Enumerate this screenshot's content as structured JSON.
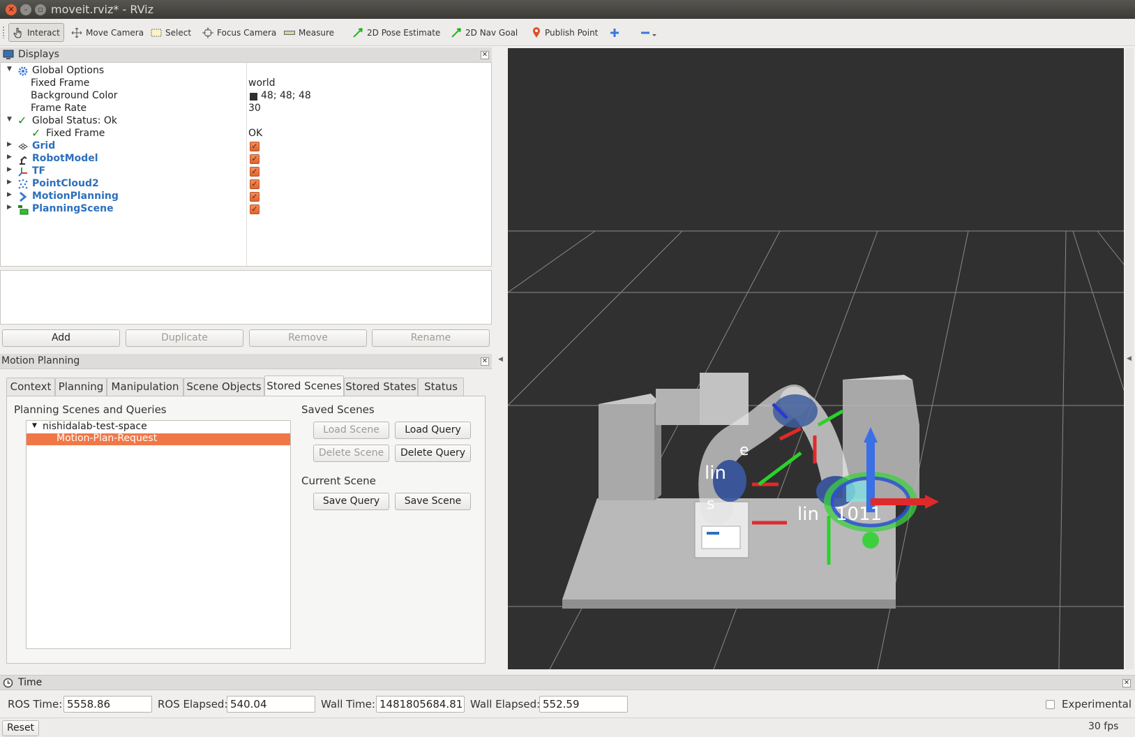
{
  "window": {
    "title": "moveit.rviz* - RViz"
  },
  "toolbar": {
    "tools": [
      {
        "label": "Interact",
        "icon": "hand-cursor-icon",
        "active": true
      },
      {
        "label": "Move Camera",
        "icon": "move-camera-icon"
      },
      {
        "label": "Select",
        "icon": "select-box-icon"
      },
      {
        "label": "Focus Camera",
        "icon": "focus-crosshair-icon"
      },
      {
        "label": "Measure",
        "icon": "ruler-icon"
      },
      {
        "label": "2D Pose Estimate",
        "icon": "green-arrow-icon"
      },
      {
        "label": "2D Nav Goal",
        "icon": "green-arrow-icon"
      },
      {
        "label": "Publish Point",
        "icon": "map-pin-icon"
      }
    ]
  },
  "displays": {
    "title": "Displays",
    "rows": [
      {
        "label": "Global Options",
        "value": ""
      },
      {
        "label": "Fixed Frame",
        "value": "world"
      },
      {
        "label": "Background Color",
        "value": "48; 48; 48"
      },
      {
        "label": "Frame Rate",
        "value": "30"
      },
      {
        "label": "Global Status: Ok",
        "value": ""
      },
      {
        "label": "Fixed Frame",
        "value": "OK"
      },
      {
        "label": "Grid",
        "enabled": true
      },
      {
        "label": "RobotModel",
        "enabled": true
      },
      {
        "label": "TF",
        "enabled": true
      },
      {
        "label": "PointCloud2",
        "enabled": true
      },
      {
        "label": "MotionPlanning",
        "enabled": true
      },
      {
        "label": "PlanningScene",
        "enabled": true
      }
    ],
    "buttons": {
      "add": "Add",
      "duplicate": "Duplicate",
      "remove": "Remove",
      "rename": "Rename"
    }
  },
  "motion_planning": {
    "title": "Motion Planning",
    "tabs": [
      "Context",
      "Planning",
      "Manipulation",
      "Scene Objects",
      "Stored Scenes",
      "Stored States",
      "Status"
    ],
    "active_tab": "Stored Scenes",
    "scenes_title": "Planning Scenes and Queries",
    "scene_tree": {
      "root": "nishidalab-test-space",
      "child": "Motion-Plan-Request"
    },
    "saved_scenes_title": "Saved Scenes",
    "current_scene_title": "Current Scene",
    "buttons": {
      "load_scene": "Load Scene",
      "load_query": "Load Query",
      "delete_scene": "Delete Scene",
      "delete_query": "Delete Query",
      "save_query": "Save Query",
      "save_scene": "Save Scene"
    }
  },
  "viewport": {
    "background_color": "#303030"
  },
  "time": {
    "title": "Time",
    "ros_time_label": "ROS Time:",
    "ros_time": "5558.86",
    "ros_elapsed_label": "ROS Elapsed:",
    "ros_elapsed": "540.04",
    "wall_time_label": "Wall Time:",
    "wall_time": "1481805684.81",
    "wall_elapsed_label": "Wall Elapsed:",
    "wall_elapsed": "552.59",
    "experimental_label": "Experimental",
    "reset_label": "Reset",
    "fps": "30 fps"
  }
}
